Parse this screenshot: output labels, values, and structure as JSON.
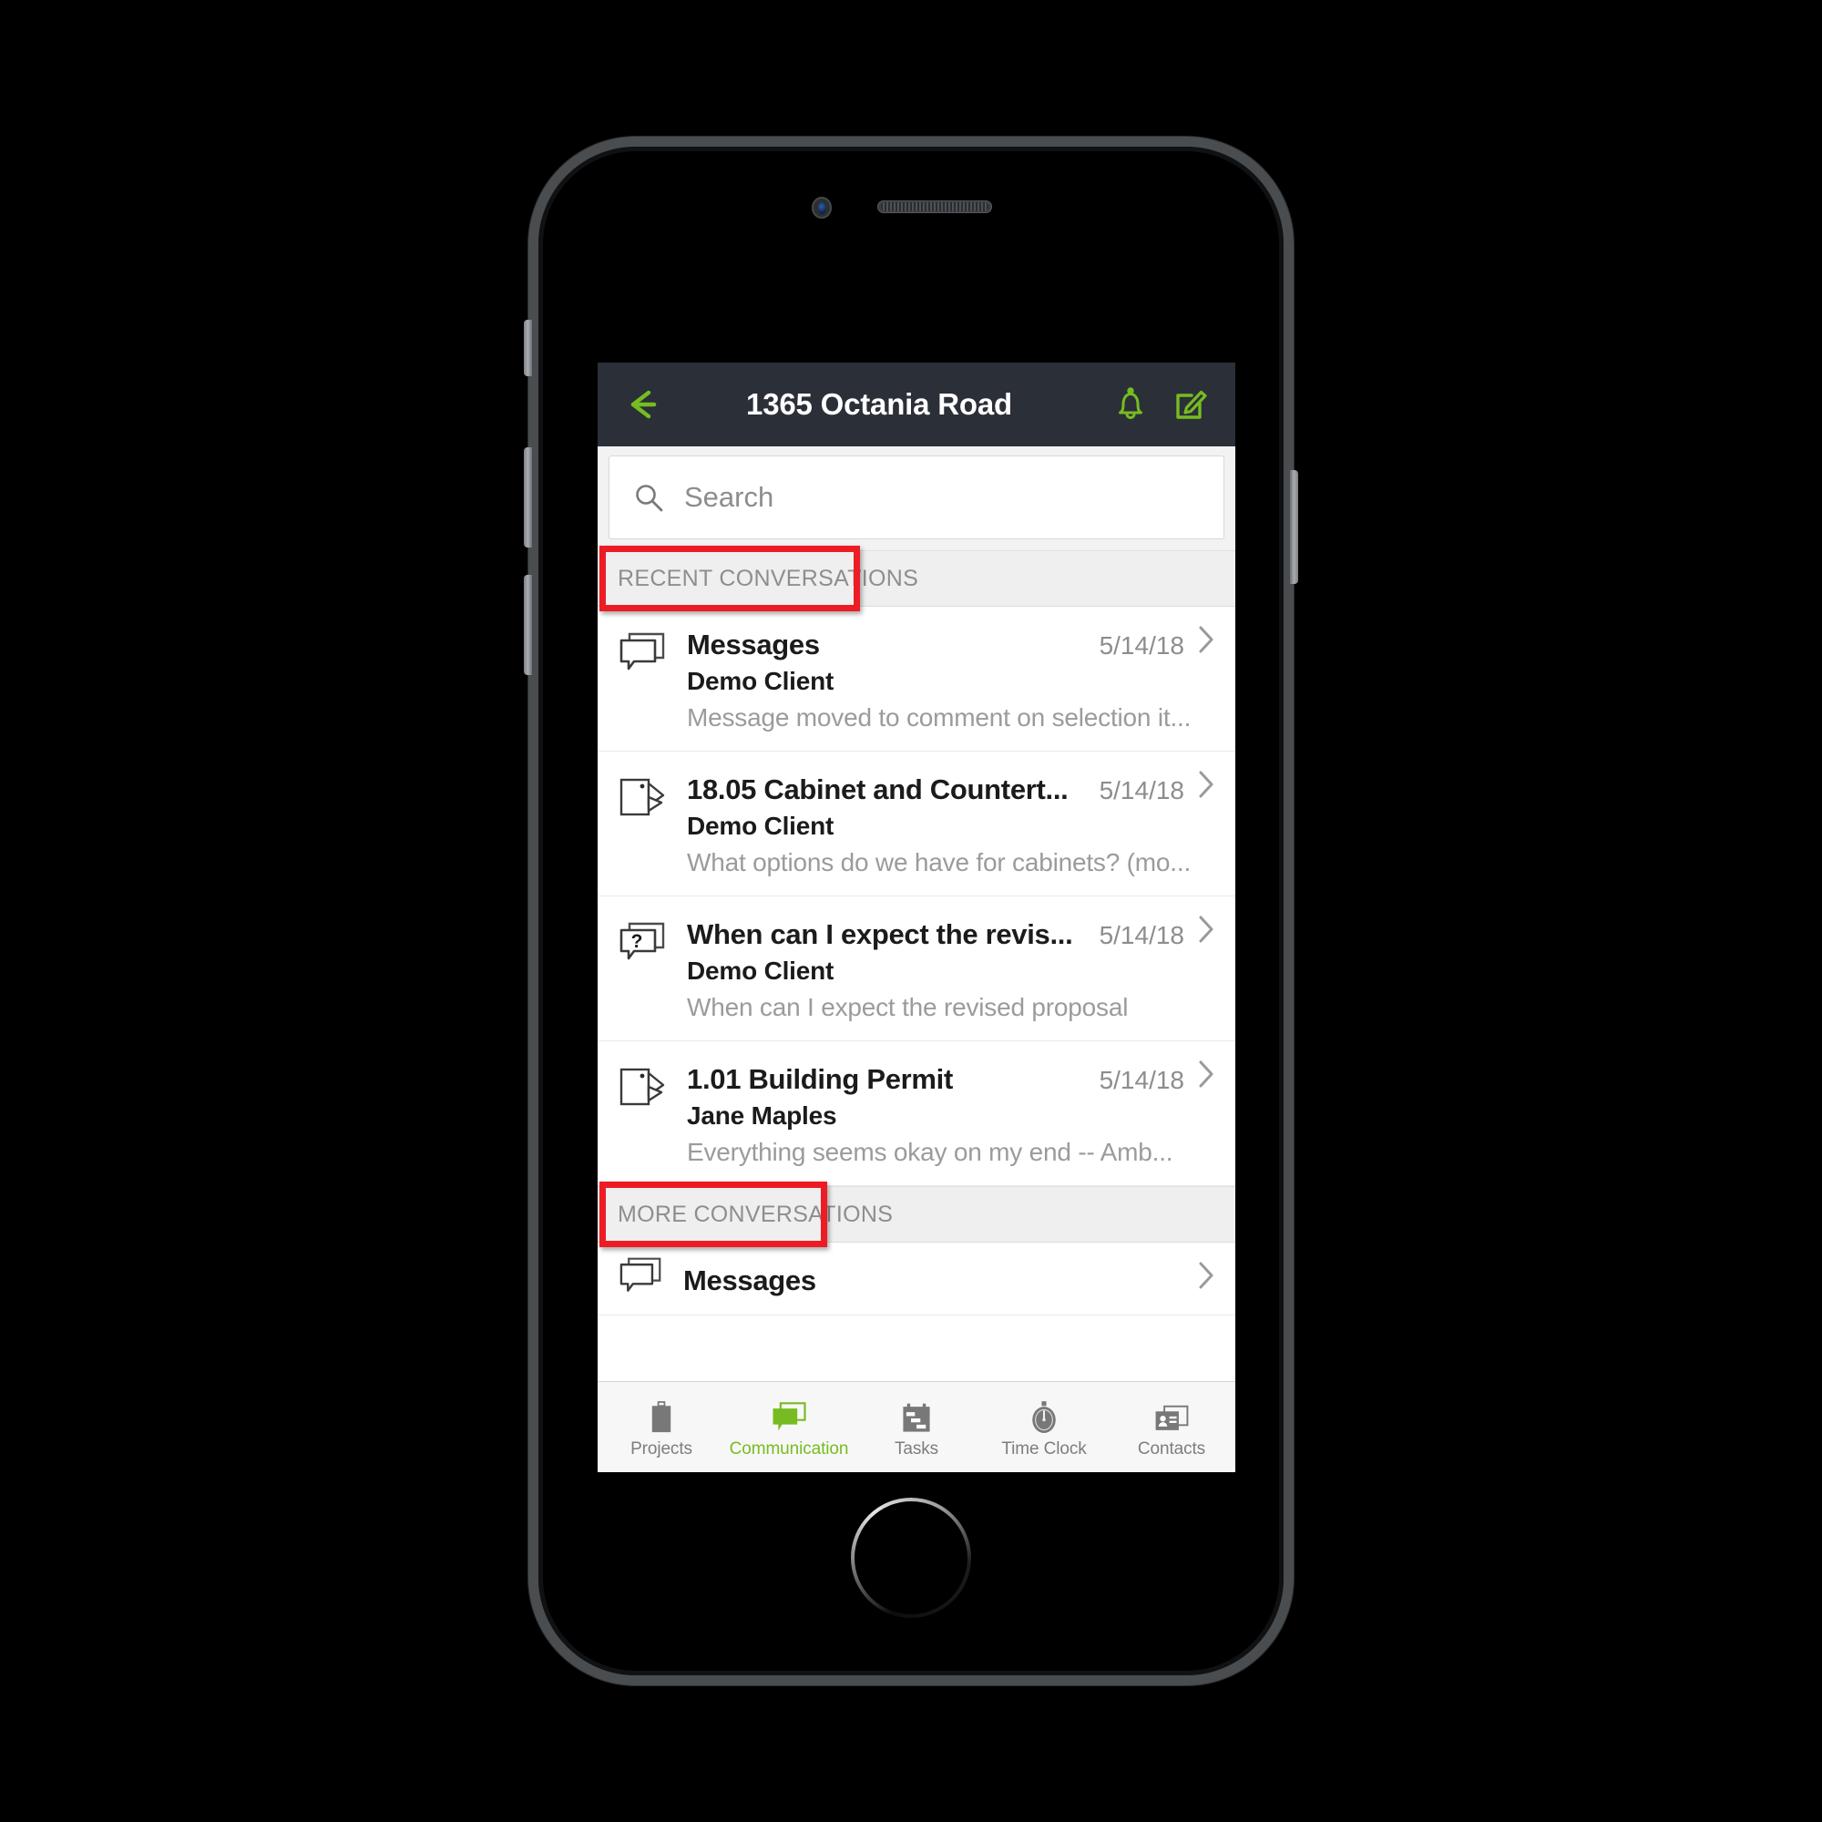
{
  "colors": {
    "accent_green": "#76bc21",
    "appbar_bg": "#2b2f38",
    "annotation_red": "#ed1c24",
    "muted_text": "#9b9b9b",
    "section_bg": "#efefef"
  },
  "appbar": {
    "back_icon": "back-arrow-icon",
    "title": "1365 Octania Road",
    "bell_icon": "bell-icon",
    "compose_icon": "compose-icon"
  },
  "search": {
    "icon": "search-icon",
    "value": "",
    "placeholder": "Search"
  },
  "sections": [
    {
      "id": "recent",
      "label": "RECENT CONVERSATIONS",
      "annotated": true
    },
    {
      "id": "more",
      "label": "MORE CONVERSATIONS",
      "annotated": true
    }
  ],
  "recent_conversations": [
    {
      "icon": "message-bubbles-icon",
      "title": "Messages",
      "date": "5/14/18",
      "sender": "Demo Client",
      "preview": "Message moved to comment on selection it...",
      "chevron": "chevron-right-icon"
    },
    {
      "icon": "document-pages-icon",
      "title": "18.05 Cabinet and Countert...",
      "date": "5/14/18",
      "sender": "Demo Client",
      "preview": "What options do we have for cabinets? (mo...",
      "chevron": "chevron-right-icon"
    },
    {
      "icon": "question-bubble-icon",
      "title": "When can I expect the revis...",
      "date": "5/14/18",
      "sender": "Demo Client",
      "preview": "When can I expect the revised proposal",
      "chevron": "chevron-right-icon"
    },
    {
      "icon": "document-pages-icon",
      "title": "1.01 Building Permit",
      "date": "5/14/18",
      "sender": "Jane Maples",
      "preview": "Everything seems okay on my end   -- Amb...",
      "chevron": "chevron-right-icon"
    }
  ],
  "more_conversations": [
    {
      "icon": "message-bubbles-icon",
      "title": "Messages",
      "chevron": "chevron-right-icon"
    }
  ],
  "tabbar": {
    "active": "Communication",
    "tabs": [
      {
        "label": "Projects",
        "icon": "clipboard-icon"
      },
      {
        "label": "Communication",
        "icon": "message-bubbles-filled-icon"
      },
      {
        "label": "Tasks",
        "icon": "gantt-calendar-icon"
      },
      {
        "label": "Time Clock",
        "icon": "stopwatch-icon"
      },
      {
        "label": "Contacts",
        "icon": "contact-card-icon"
      }
    ]
  },
  "device": {
    "camera": "front-camera",
    "speaker": "earpiece-speaker",
    "home_button": "home-button",
    "mute_switch": "mute-switch",
    "volume_up": "volume-up-button",
    "volume_down": "volume-down-button",
    "power": "power-button"
  }
}
